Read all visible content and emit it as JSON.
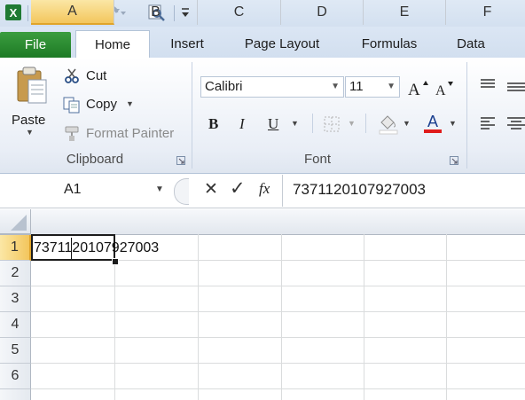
{
  "qat": {
    "icons": [
      "excel-logo-icon",
      "save-icon",
      "undo-icon",
      "redo-icon",
      "print-preview-icon",
      "customize-qat-icon"
    ]
  },
  "tabs": [
    "File",
    "Home",
    "Insert",
    "Page Layout",
    "Formulas",
    "Data"
  ],
  "clipboard": {
    "paste_label": "Paste",
    "cut_label": "Cut",
    "copy_label": "Copy",
    "format_painter_label": "Format Painter",
    "group_label": "Clipboard"
  },
  "font": {
    "font_name": "Calibri",
    "font_size": "11",
    "bold": "B",
    "italic": "I",
    "underline": "U",
    "group_label": "Font",
    "font_color": "#e01b1b"
  },
  "formula_bar": {
    "name_box": "A1",
    "cancel": "✕",
    "enter": "✓",
    "fx": "fx",
    "value": "7371120107927003"
  },
  "grid": {
    "columns": [
      "A",
      "B",
      "C",
      "D",
      "E",
      "F"
    ],
    "rows": [
      "1",
      "2",
      "3",
      "4",
      "5",
      "6"
    ],
    "a1_value": "7371120107927003",
    "selected_cell": "A1"
  },
  "colors": {
    "file_tab": "#2b8a31",
    "selection_header": "#f8d36b",
    "accent": "#2a4f86"
  }
}
